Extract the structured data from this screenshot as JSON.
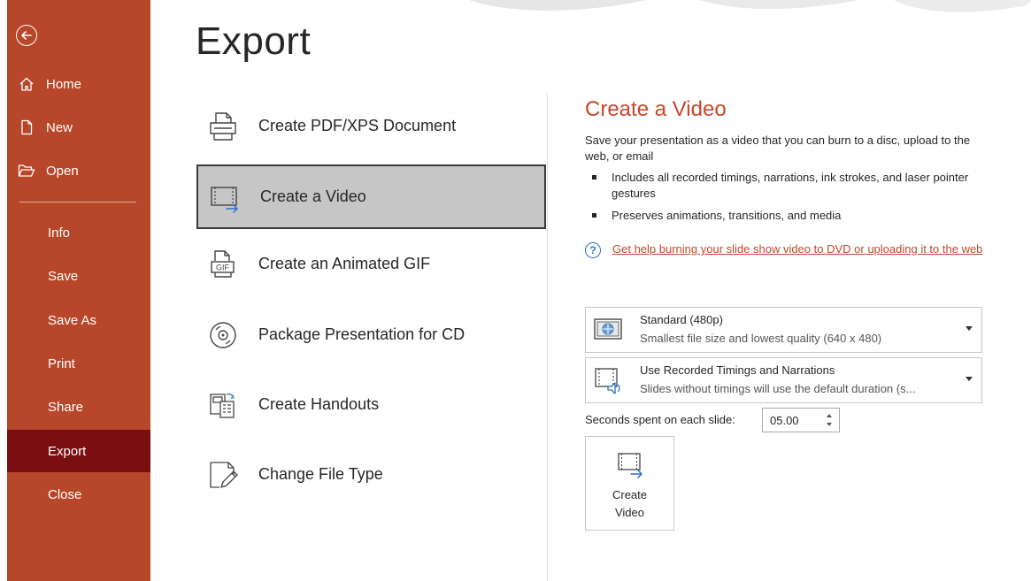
{
  "sidebar": {
    "back_icon": "back-arrow-circle-icon",
    "items": [
      {
        "label": "Home",
        "icon": "home-icon"
      },
      {
        "label": "New",
        "icon": "new-document-icon"
      },
      {
        "label": "Open",
        "icon": "folder-open-icon"
      },
      {
        "label": "Info"
      },
      {
        "label": "Save"
      },
      {
        "label": "Save As"
      },
      {
        "label": "Print"
      },
      {
        "label": "Share"
      },
      {
        "label": "Export",
        "active": true
      },
      {
        "label": "Close"
      }
    ],
    "colors": {
      "background": "#b7472a",
      "active": "#7a0e10"
    }
  },
  "page": {
    "title": "Export"
  },
  "export_options": [
    {
      "label": "Create PDF/XPS Document",
      "icon": "pdf-printer-icon"
    },
    {
      "label": "Create a Video",
      "icon": "video-icon",
      "selected": true
    },
    {
      "label": "Create an Animated GIF",
      "icon": "gif-icon"
    },
    {
      "label": "Package Presentation for CD",
      "icon": "cd-icon"
    },
    {
      "label": "Create Handouts",
      "icon": "handouts-icon"
    },
    {
      "label": "Change File Type",
      "icon": "change-file-type-icon"
    }
  ],
  "video_pane": {
    "title": "Create a Video",
    "description": "Save your presentation as a video that you can burn to a disc, upload to the web, or email",
    "bullets": [
      "Includes all recorded timings, narrations, ink strokes, and laser pointer gestures",
      "Preserves animations, transitions, and media"
    ],
    "help_link": "Get help burning your slide show video to DVD or uploading it to the web",
    "quality_dropdown": {
      "main": "Standard (480p)",
      "sub": "Smallest file size and lowest quality (640 x 480)"
    },
    "timings_dropdown": {
      "main": "Use Recorded Timings and Narrations",
      "sub": "Slides without timings will use the default duration (s..."
    },
    "seconds_label": "Seconds spent on each slide:",
    "seconds_value": "05.00",
    "create_button_line1": "Create",
    "create_button_line2": "Video",
    "accent_color": "#c5482a"
  }
}
